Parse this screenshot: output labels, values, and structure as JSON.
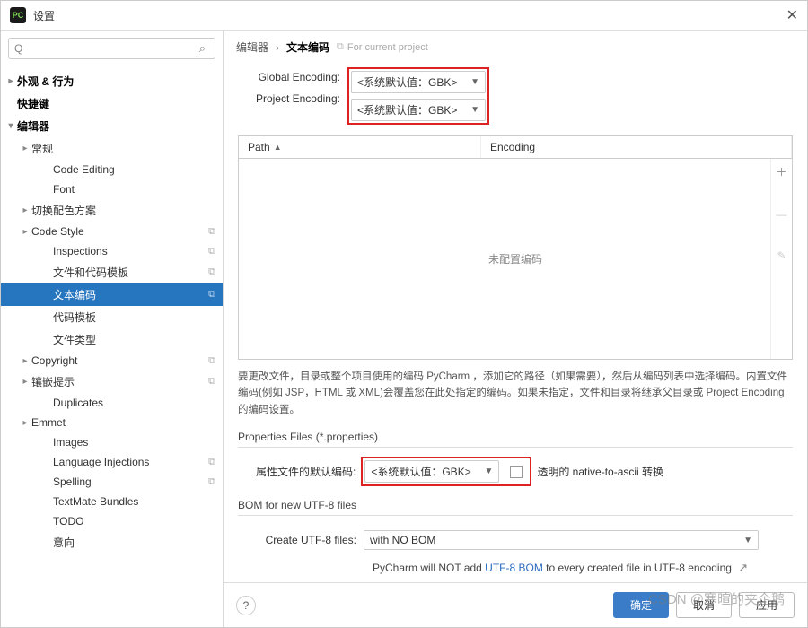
{
  "window": {
    "title": "设置"
  },
  "search": {
    "placeholder": ""
  },
  "sidebar": {
    "items": [
      {
        "label": "外观 & 行为",
        "depth": 0,
        "arrow": "▸",
        "bold": true
      },
      {
        "label": "快捷键",
        "depth": 0,
        "arrow": "",
        "bold": true
      },
      {
        "label": "编辑器",
        "depth": 0,
        "arrow": "▾",
        "bold": true
      },
      {
        "label": "常规",
        "depth": 1,
        "arrow": "▸"
      },
      {
        "label": "Code Editing",
        "depth": 2,
        "arrow": ""
      },
      {
        "label": "Font",
        "depth": 2,
        "arrow": ""
      },
      {
        "label": "切换配色方案",
        "depth": 1,
        "arrow": "▸"
      },
      {
        "label": "Code Style",
        "depth": 1,
        "arrow": "▸",
        "badge": "⧉"
      },
      {
        "label": "Inspections",
        "depth": 2,
        "arrow": "",
        "badge": "⧉"
      },
      {
        "label": "文件和代码模板",
        "depth": 2,
        "arrow": "",
        "badge": "⧉"
      },
      {
        "label": "文本编码",
        "depth": 2,
        "arrow": "",
        "badge": "⧉",
        "selected": true
      },
      {
        "label": "代码模板",
        "depth": 2,
        "arrow": ""
      },
      {
        "label": "文件类型",
        "depth": 2,
        "arrow": ""
      },
      {
        "label": "Copyright",
        "depth": 1,
        "arrow": "▸",
        "badge": "⧉"
      },
      {
        "label": "镶嵌提示",
        "depth": 1,
        "arrow": "▸",
        "badge": "⧉"
      },
      {
        "label": "Duplicates",
        "depth": 2,
        "arrow": ""
      },
      {
        "label": "Emmet",
        "depth": 1,
        "arrow": "▸"
      },
      {
        "label": "Images",
        "depth": 2,
        "arrow": ""
      },
      {
        "label": "Language Injections",
        "depth": 2,
        "arrow": "",
        "badge": "⧉"
      },
      {
        "label": "Spelling",
        "depth": 2,
        "arrow": "",
        "badge": "⧉"
      },
      {
        "label": "TextMate Bundles",
        "depth": 2,
        "arrow": ""
      },
      {
        "label": "TODO",
        "depth": 2,
        "arrow": ""
      },
      {
        "label": "意向",
        "depth": 2,
        "arrow": ""
      }
    ]
  },
  "breadcrumb": {
    "parent": "编辑器",
    "current": "文本编码",
    "scope": "For current project"
  },
  "encoding": {
    "globalLabel": "Global Encoding:",
    "globalValue": "<系统默认值：GBK>",
    "projectLabel": "Project Encoding:",
    "projectValue": "<系统默认值：GBK>"
  },
  "table": {
    "pathHeader": "Path",
    "encHeader": "Encoding",
    "empty": "未配置编码"
  },
  "hint": "要更改文件，目录或整个项目使用的编码 PyCharm ，添加它的路径（如果需要），然后从编码列表中选择编码。内置文件编码(例如 JSP，HTML 或 XML)会覆盖您在此处指定的编码。如果未指定，文件和目录将继承父目录或 Project Encoding 的编码设置。",
  "properties": {
    "groupLabel": "Properties Files (*.properties)",
    "defaultLabel": "属性文件的默认编码:",
    "defaultValue": "<系统默认值：GBK>",
    "transparentLabel": "透明的 native-to-ascii 转换"
  },
  "bom": {
    "groupLabel": "BOM for new UTF-8 files",
    "createLabel": "Create UTF-8 files:",
    "createValue": "with NO BOM",
    "note1": "PyCharm will NOT add ",
    "noteLink": "UTF-8 BOM",
    "note2": " to every created file in UTF-8 encoding"
  },
  "footer": {
    "ok": "确定",
    "cancel": "取消",
    "apply": "应用"
  },
  "watermark": "CSDN @寒暄的夹企鹅"
}
